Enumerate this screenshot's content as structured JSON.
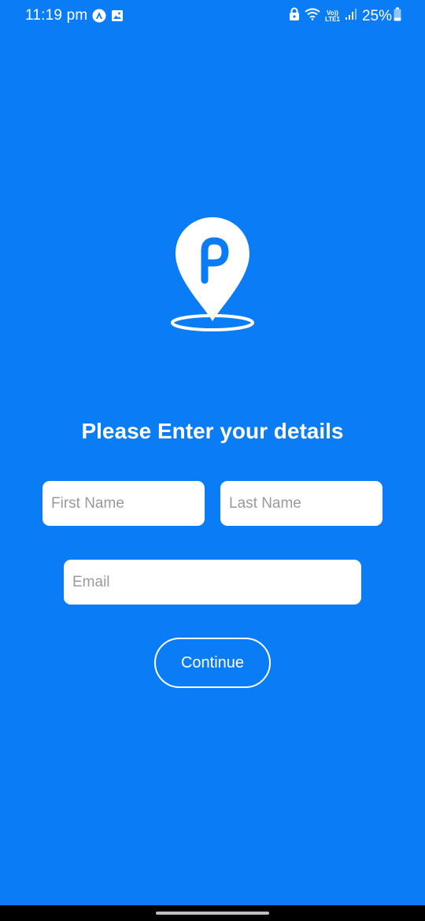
{
  "status_bar": {
    "time": "11:19 pm",
    "battery": "25%",
    "icons": [
      "app-notification-icon",
      "gallery-icon",
      "lock-icon",
      "wifi-icon",
      "volte-icon",
      "signal-icon",
      "battery-icon"
    ],
    "volte_top": "Vo))",
    "volte_bottom": "LTE1"
  },
  "logo": {
    "icon": "location-pin-p-icon",
    "letter": "P"
  },
  "form": {
    "title": "Please Enter your details",
    "first_name_placeholder": "First Name",
    "first_name_value": "",
    "last_name_placeholder": "Last Name",
    "last_name_value": "",
    "email_placeholder": "Email",
    "email_value": "",
    "continue_label": "Continue"
  },
  "colors": {
    "background": "#0a7cf6",
    "foreground": "#ffffff",
    "field": "#ffffff",
    "placeholder": "#9a9a9a"
  }
}
